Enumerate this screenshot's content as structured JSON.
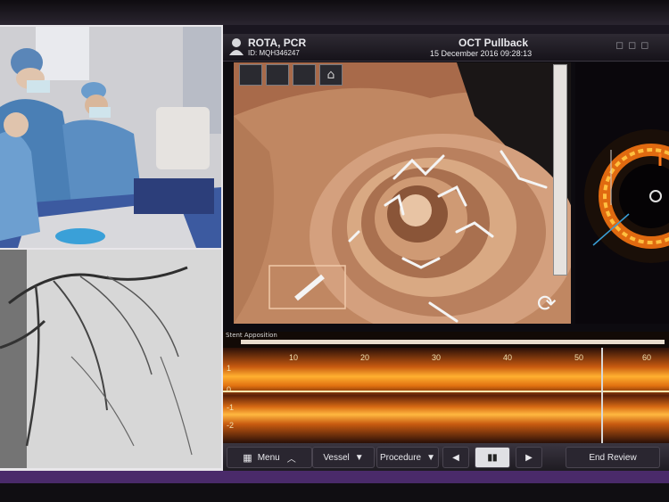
{
  "header": {
    "patient_name": "ROTA, PCR",
    "patient_id": "ID: MQH346247",
    "mode_title": "OCT Pullback",
    "date_time": "15 December 2016 09:28:13"
  },
  "long_view": {
    "label": "Stent Apposition",
    "ticks": [
      "10",
      "20",
      "30",
      "40",
      "50",
      "60"
    ],
    "left_marks": [
      "1",
      "0",
      "-1",
      "-2"
    ]
  },
  "toolbar": {
    "menu_label": "Menu",
    "vessel_label": "Vessel",
    "procedure_label": "Procedure",
    "end_review_label": "End Review"
  },
  "colors": {
    "accent": "#f0a020",
    "tissue": "#c98f6a",
    "frame": "#4a2a6a"
  }
}
